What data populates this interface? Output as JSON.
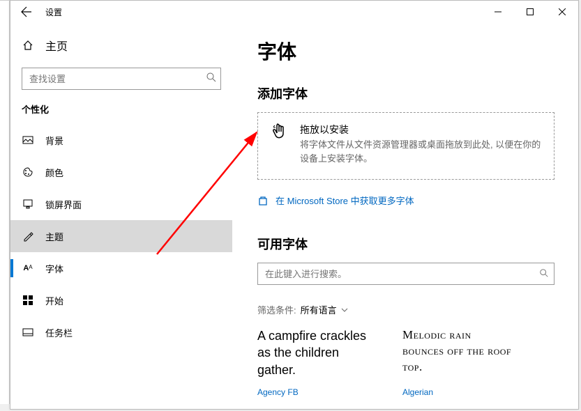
{
  "titlebar": {
    "title": "设置"
  },
  "sidebar": {
    "home": "主页",
    "search_placeholder": "查找设置",
    "section": "个性化",
    "items": [
      {
        "id": "background",
        "label": "背景"
      },
      {
        "id": "color",
        "label": "颜色"
      },
      {
        "id": "lockscreen",
        "label": "锁屏界面"
      },
      {
        "id": "theme",
        "label": "主题"
      },
      {
        "id": "fonts",
        "label": "字体"
      },
      {
        "id": "start",
        "label": "开始"
      },
      {
        "id": "taskbar",
        "label": "任务栏"
      }
    ]
  },
  "main": {
    "heading": "字体",
    "add_heading": "添加字体",
    "dropzone_title": "拖放以安装",
    "dropzone_desc": "将字体文件从文件资源管理器或桌面拖放到此处, 以便在你的设备上安装字体。",
    "store_link": "在 Microsoft Store 中获取更多字体",
    "available_heading": "可用字体",
    "font_search_placeholder": "在此键入进行搜索。",
    "filter_label": "筛选条件:",
    "filter_value": "所有语言",
    "fonts": [
      {
        "sample": "A campfire crackles as the children gather.",
        "name": "Agency FB"
      },
      {
        "sample": "Melodic rain bounces off the roof top.",
        "name": "Algerian"
      }
    ]
  }
}
